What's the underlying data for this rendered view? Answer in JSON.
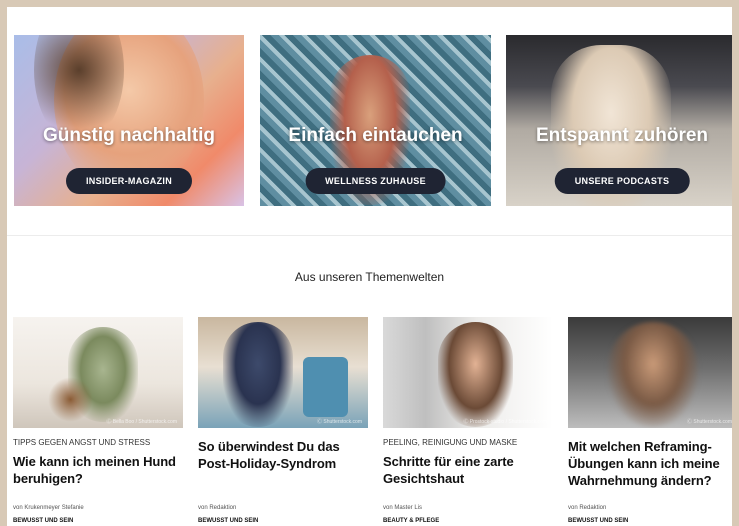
{
  "heroes": [
    {
      "title": "Günstig nachhaltig",
      "button": "INSIDER-MAGAZIN"
    },
    {
      "title": "Einfach eintauchen",
      "button": "WELLNESS ZUHAUSE"
    },
    {
      "title": "Entspannt zuhören",
      "button": "UNSERE PODCASTS"
    }
  ],
  "section": {
    "title": "Aus unseren Themenwelten"
  },
  "articles": [
    {
      "kicker": "TIPPS GEGEN ANGST UND STRESS",
      "headline": "Wie kann ich meinen Hund beruhigen?",
      "author": "von Krukenmeyer Stefanie",
      "category": "BEWUSST UND SEIN",
      "credit": "Ⓒ Bella Boo / Shutterstock.com"
    },
    {
      "kicker": "",
      "headline": "So überwindest Du das Post-Holiday-Syndrom",
      "author": "von Redaktion",
      "category": "BEWUSST UND SEIN",
      "credit": "Ⓒ Shutterstock.com"
    },
    {
      "kicker": "PEELING, REINIGUNG UND MASKE",
      "headline": "Schritte für eine zarte Gesichtshaut",
      "author": "von Master Lis",
      "category": "BEAUTY & PFLEGE",
      "credit": "Ⓒ Prostock-studio / Shutterstock.com"
    },
    {
      "kicker": "",
      "headline": "Mit welchen Reframing-Übungen kann ich meine Wahrnehmung ändern?",
      "author": "von Redaktion",
      "category": "BEWUSST UND SEIN",
      "credit": "Ⓒ Shutterstock.com"
    }
  ]
}
